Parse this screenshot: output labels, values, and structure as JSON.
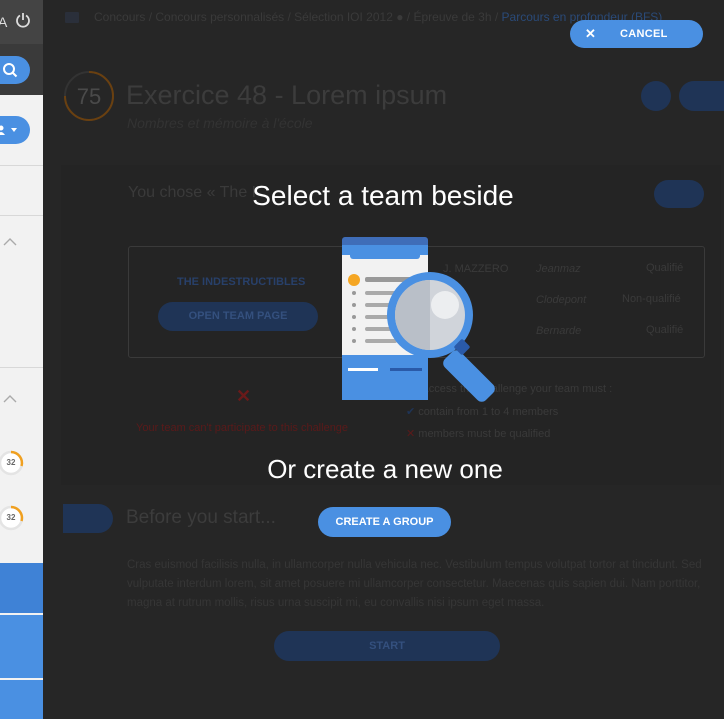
{
  "sidebar": {
    "top_letter": "A",
    "progress_items": [
      {
        "value": "32"
      },
      {
        "value": "32"
      }
    ]
  },
  "background": {
    "breadcrumb": {
      "items": [
        "Concours",
        "Concours personnalisés",
        "Sélection IOI 2012",
        "Épreuve de 3h"
      ],
      "current": "Parcours en profondeur (BFS)",
      "separator": " / "
    },
    "score": "75",
    "title": "Exercice 48 - Lorem ipsum",
    "subtitle": "Nombres et mémoire à l'école",
    "team_section": {
      "you_chose": "You chose « The I",
      "team_name": "THE INDESTRUCTIBLES",
      "open_team_label": "OPEN TEAM PAGE",
      "members": [
        {
          "name": "J. MAZZERO",
          "login": "Jeanmaz",
          "status": "Qualifié"
        },
        {
          "name": "",
          "login": "Clodepont",
          "status": "Non-qualifié"
        },
        {
          "name": "",
          "login": "Bernarde",
          "status": "Qualifié"
        }
      ],
      "cant_participate": "Your team can't participate to this challenge",
      "rules_title": "To access this challenge your team must :",
      "rules": [
        {
          "ok": true,
          "text": "contain from 1 to 4 members"
        },
        {
          "ok": false,
          "text": "members must be qualified"
        }
      ]
    },
    "before": {
      "title": "Before you start...",
      "text": "Cras euismod facilisis nulla, in ullamcorper nulla vehicula nec. Vestibulum tempus volutpat tortor at tincidunt. Sed vulputate interdum lorem, sit amet posuere mi ullamcorper consectetur. Maecenas quis sapien dui. Nam porttitor, magna at rutrum mollis, risus urna suscipit mi, eu convallis nisi ipsum eget massa.",
      "start_label": "START"
    }
  },
  "modal": {
    "cancel_label": "CANCEL",
    "title": "Select a team beside",
    "or_text": "Or create a new one",
    "create_label": "CREATE A GROUP"
  },
  "colors": {
    "accent": "#4a90e2",
    "overlay_button": "#1f3456"
  }
}
